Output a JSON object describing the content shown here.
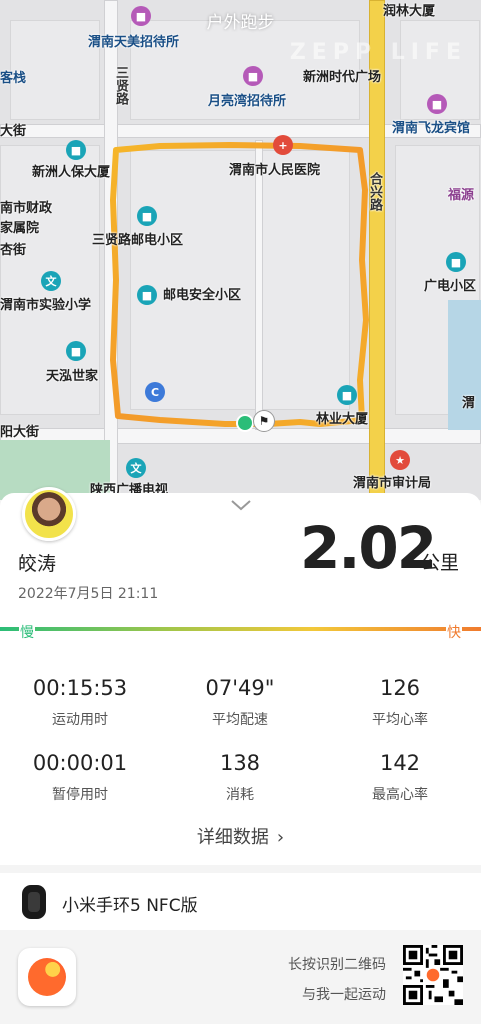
{
  "map": {
    "title": "户外跑步",
    "watermark": "ZEPP LIFE",
    "labels": {
      "runlin": "润林大厦",
      "tianmei": "渭南天美招待所",
      "kezhan": "客栈",
      "xinzhou_plaza": "新洲时代广场",
      "sanxian_road": "三贤路",
      "yueliangwan": "月亮湾招待所",
      "dajie_top": "大街",
      "feilong": "渭南飞龙宾馆",
      "renbao": "新洲人保大厦",
      "hospital": "渭南市人民医院",
      "caizheng1": "南市财政",
      "caizheng2": "家属院",
      "heyi_road": "合兴路",
      "fuyuan": "福源",
      "xiaoqu": "三贤路邮电小区",
      "jie": "杏街",
      "guangdian": "广电小区",
      "school": "渭南市实验小学",
      "youdian": "邮电安全小区",
      "tianhong": "天泓世家",
      "wei": "渭",
      "dajie_bottom": "阳大街",
      "linye": "林业大厦",
      "audit": "渭南市审计局",
      "radio": "陕西广播电视"
    }
  },
  "card": {
    "user_name": "皎涛",
    "date": "2022年7月5日 21:11",
    "distance": "2.02",
    "distance_unit": "公里",
    "pace_slow": "慢",
    "pace_fast": "快",
    "stats": [
      {
        "value": "00:15:53",
        "label": "运动用时"
      },
      {
        "value": "07'49\"",
        "label": "平均配速"
      },
      {
        "value": "126",
        "label": "平均心率"
      },
      {
        "value": "00:00:01",
        "label": "暂停用时"
      },
      {
        "value": "138",
        "label": "消耗"
      },
      {
        "value": "142",
        "label": "最高心率"
      }
    ],
    "details_label": "详细数据",
    "device_name": "小米手环5 NFC版"
  },
  "footer": {
    "qr_hint_line1": "长按识别二维码",
    "qr_hint_line2": "与我一起运动"
  },
  "colors": {
    "pace_slow": "#2bbd78",
    "pace_fast": "#f07b2e",
    "route": "#f5a623"
  }
}
